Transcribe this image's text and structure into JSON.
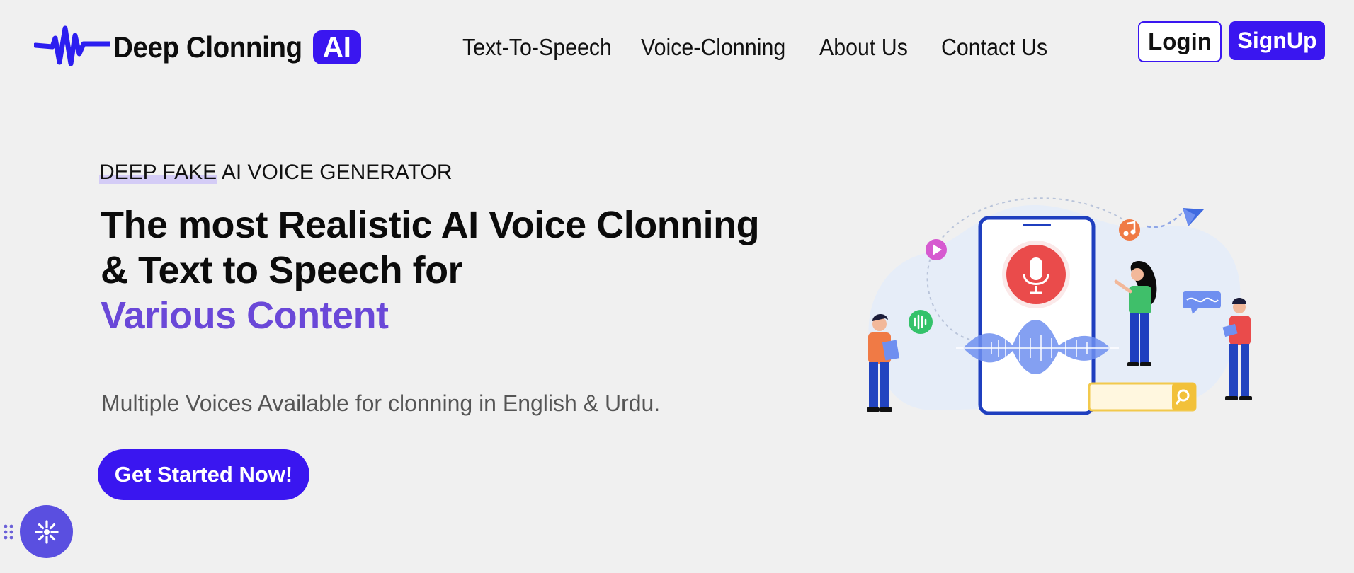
{
  "brand": {
    "name": "Deep Clonning",
    "badge": "AI",
    "accent_color": "#3a16f0"
  },
  "nav": {
    "items": [
      {
        "label": "Text-To-Speech"
      },
      {
        "label": "Voice-Clonning"
      },
      {
        "label": "About Us"
      },
      {
        "label": "Contact Us"
      }
    ]
  },
  "auth": {
    "login_label": "Login",
    "signup_label": "SignUp"
  },
  "hero": {
    "kicker_highlight": "DEEP FAKE",
    "kicker_rest": " AI VOICE GENERATOR",
    "headline_line1": "The most Realistic AI Voice Clonning",
    "headline_line2": "& Text to Speech for",
    "headline_accent": "Various Content",
    "accent_color": "#6a48d8",
    "subtitle": "Multiple Voices Available for clonning in English & Urdu.",
    "cta_label": "Get Started Now!"
  },
  "widget": {
    "icon": "sparkle-icon"
  },
  "illustration": {
    "icons": [
      "microphone-icon",
      "play-icon",
      "music-note-icon",
      "paper-plane-icon",
      "audio-bars-icon",
      "search-icon"
    ]
  }
}
